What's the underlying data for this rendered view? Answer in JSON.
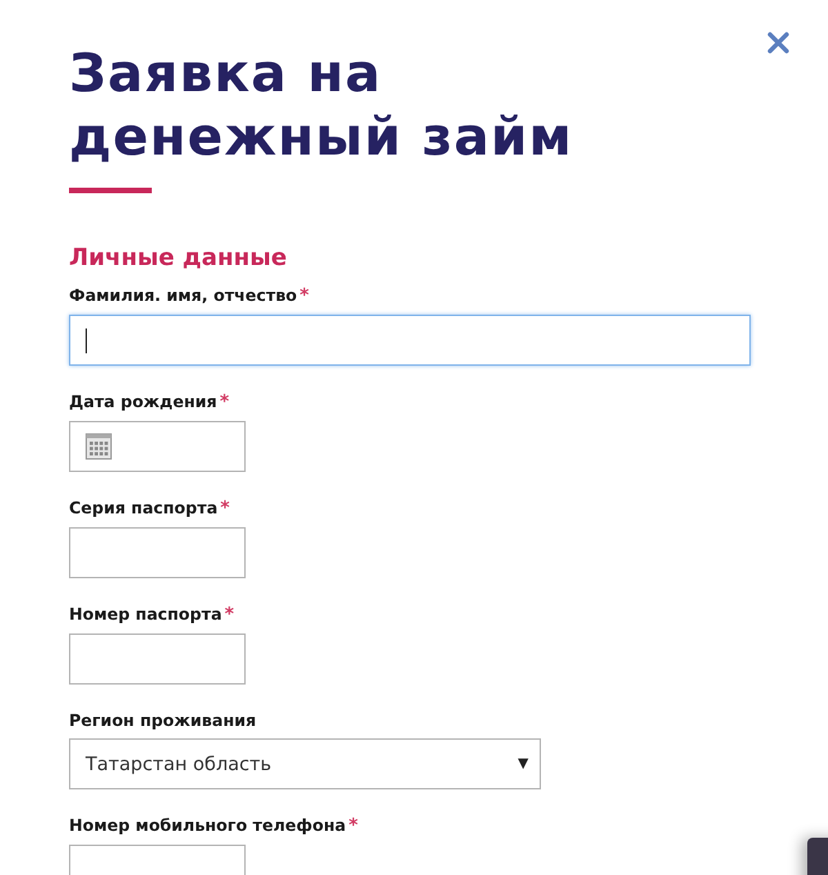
{
  "dialog": {
    "title_lines": [
      "Заявка на",
      "денежный займ"
    ]
  },
  "section": {
    "title": "Личные данные"
  },
  "fields": [
    {
      "kind": "text",
      "label": "Фамилия. имя, отчество",
      "required_mark": "*",
      "full_width": true,
      "focused": true
    },
    {
      "kind": "date",
      "label": "Дата рождения",
      "required_mark": "*",
      "focused": false
    },
    {
      "kind": "text",
      "label": "Серия паспорта",
      "required_mark": "*",
      "full_width": false,
      "focused": false
    },
    {
      "kind": "text",
      "label": "Номер паспорта",
      "required_mark": "*",
      "full_width": false,
      "focused": false
    },
    {
      "kind": "select",
      "label": "Регион проживания",
      "value": "Татарстан область",
      "arrow": "▼"
    },
    {
      "kind": "text",
      "label": "Номер мобильного телефона",
      "required_mark": "*",
      "full_width": false,
      "focused": false
    }
  ]
}
